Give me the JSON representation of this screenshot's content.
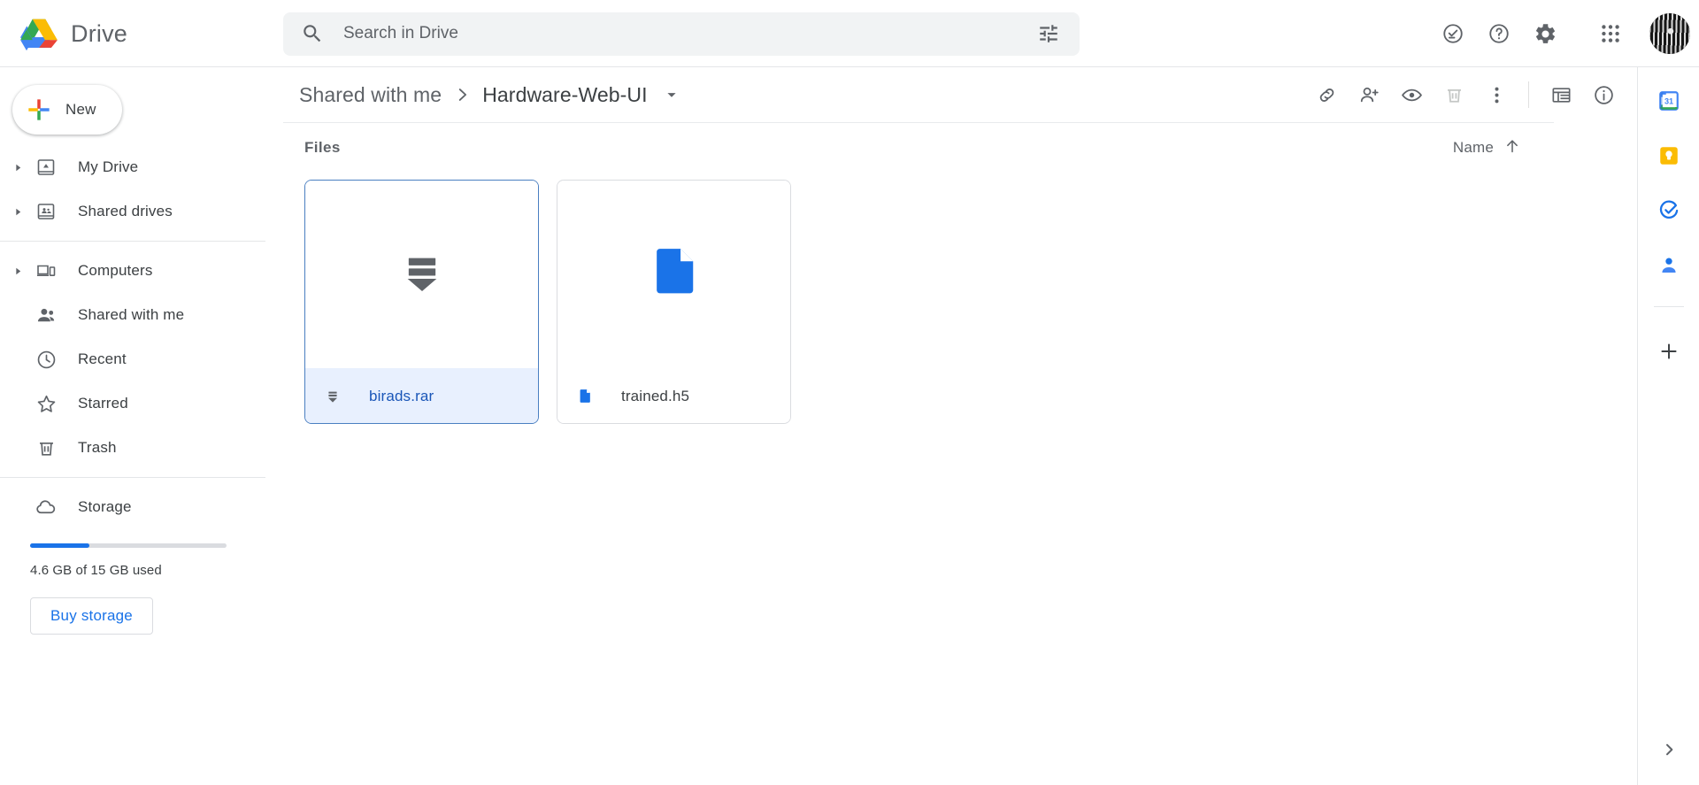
{
  "app": {
    "name": "Drive",
    "logo_icon": "drive-logo-icon"
  },
  "search": {
    "placeholder": "Search in Drive",
    "value": "",
    "search_icon": "search-icon",
    "options_icon": "tune-icon"
  },
  "header_actions": [
    {
      "name": "activity-icon",
      "label": "Activity"
    },
    {
      "name": "help-icon",
      "label": "Support"
    },
    {
      "name": "gear-icon",
      "label": "Settings"
    },
    {
      "name": "apps-grid-icon",
      "label": "Google apps"
    },
    {
      "name": "avatar",
      "label": "Google Account"
    }
  ],
  "sidebar": {
    "new_button": {
      "label": "New",
      "icon": "plus-icon"
    },
    "items": [
      {
        "label": "My Drive",
        "icon": "my-drive-icon",
        "expandable": true,
        "active": false
      },
      {
        "label": "Shared drives",
        "icon": "shared-drives-icon",
        "expandable": true,
        "active": false
      },
      {
        "label": "Computers",
        "icon": "computers-icon",
        "expandable": true,
        "active": false
      },
      {
        "label": "Shared with me",
        "icon": "people-icon",
        "expandable": false,
        "active": false
      },
      {
        "label": "Recent",
        "icon": "clock-icon",
        "expandable": false,
        "active": false
      },
      {
        "label": "Starred",
        "icon": "star-icon",
        "expandable": false,
        "active": false
      },
      {
        "label": "Trash",
        "icon": "trash-icon",
        "expandable": false,
        "active": false
      }
    ],
    "storage": {
      "label": "Storage",
      "icon": "cloud-icon",
      "used_text": "4.6 GB of 15 GB used",
      "percent": 30,
      "bar_color": "#1a73e8",
      "buy_label": "Buy storage"
    }
  },
  "breadcrumb": {
    "parent": "Shared with me",
    "separator": "chevron-right-icon",
    "current": "Hardware-Web-UI",
    "caret_icon": "arrow-drop-down-icon"
  },
  "toolbar": [
    {
      "name": "get-link-icon",
      "label": "Get link",
      "disabled": false
    },
    {
      "name": "add-person-icon",
      "label": "Share",
      "disabled": false
    },
    {
      "name": "eye-icon",
      "label": "Preview",
      "disabled": false
    },
    {
      "name": "trash-icon",
      "label": "Remove",
      "disabled": true
    },
    {
      "name": "more-vert-icon",
      "label": "More actions",
      "disabled": false
    },
    {
      "name": "list-view-icon",
      "label": "List layout",
      "disabled": false
    },
    {
      "name": "info-icon",
      "label": "View details",
      "disabled": false
    }
  ],
  "main": {
    "section_title": "Files",
    "sort": {
      "label": "Name",
      "direction_icon": "arrow-up-icon"
    },
    "files": [
      {
        "name": "birads.rar",
        "thumb_icon": "archive-icon",
        "foot_icon": "archive-icon",
        "selected": true,
        "accent": "#5f6368"
      },
      {
        "name": "trained.h5",
        "thumb_icon": "generic-file-icon",
        "foot_icon": "generic-file-icon",
        "selected": false,
        "accent": "#1a73e8"
      }
    ]
  },
  "right_panel": {
    "apps": [
      {
        "name": "google-calendar-icon",
        "label": "Calendar"
      },
      {
        "name": "google-keep-icon",
        "label": "Keep"
      },
      {
        "name": "google-tasks-icon",
        "label": "Tasks"
      },
      {
        "name": "google-contacts-icon",
        "label": "Contacts"
      }
    ],
    "add": {
      "name": "plus-icon",
      "label": "Get add-ons"
    },
    "expand": {
      "name": "chevron-right-icon",
      "label": "Show side panel"
    }
  },
  "colors": {
    "accent_blue": "#1a73e8",
    "selected_bg": "#e8f0fe",
    "text_primary": "#3c4043",
    "text_secondary": "#5f6368",
    "divider": "#e4e6e8"
  }
}
